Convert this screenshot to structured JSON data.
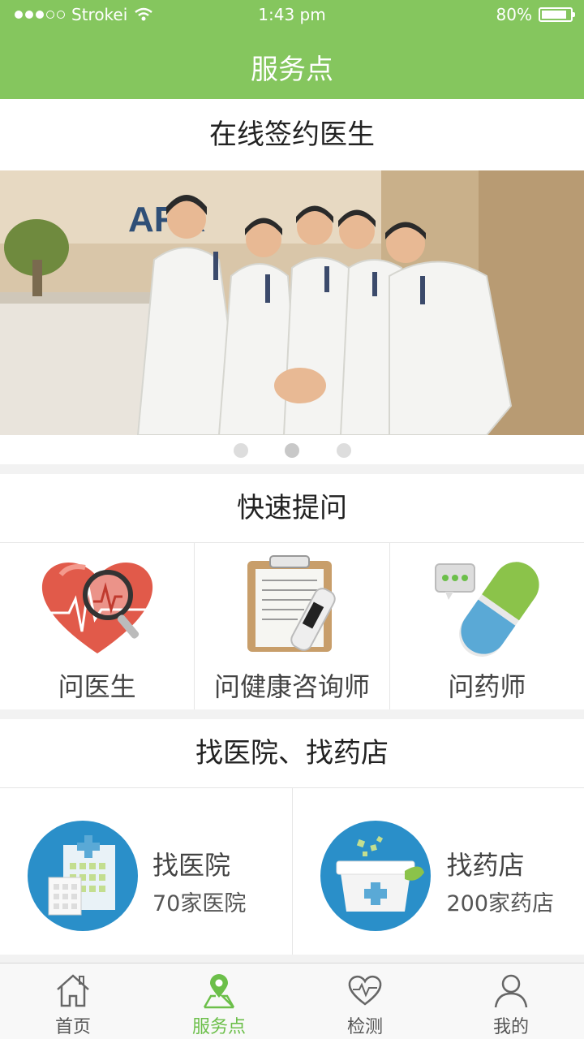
{
  "status_bar": {
    "carrier": "Strokei",
    "time": "1:43 pm",
    "battery": "80%"
  },
  "nav": {
    "title": "服务点"
  },
  "sections": {
    "sign_doctor": "在线签约医生",
    "quick_ask": "快速提问",
    "find": "找医院、找药店"
  },
  "banner": {
    "pages": 3,
    "active_page": 2,
    "photo_text": "ARR"
  },
  "quick_ask_items": [
    {
      "label": "问医生",
      "icon": "heart-magnifier-icon"
    },
    {
      "label": "问健康咨询师",
      "icon": "clipboard-thermometer-icon"
    },
    {
      "label": "问药师",
      "icon": "pill-chat-icon"
    }
  ],
  "find_items": [
    {
      "title": "找医院",
      "count": "70家医院",
      "icon": "hospital-icon"
    },
    {
      "title": "找药店",
      "count": "200家药店",
      "icon": "medicine-box-icon"
    }
  ],
  "tabs": [
    {
      "label": "首页",
      "icon": "home-icon"
    },
    {
      "label": "服务点",
      "icon": "location-pin-icon",
      "active": true
    },
    {
      "label": "检测",
      "icon": "heart-pulse-icon"
    },
    {
      "label": "我的",
      "icon": "user-icon"
    }
  ],
  "colors": {
    "accent": "#85c65e",
    "tab_active": "#6cbf4a",
    "icon_blue": "#2a8fc9"
  }
}
